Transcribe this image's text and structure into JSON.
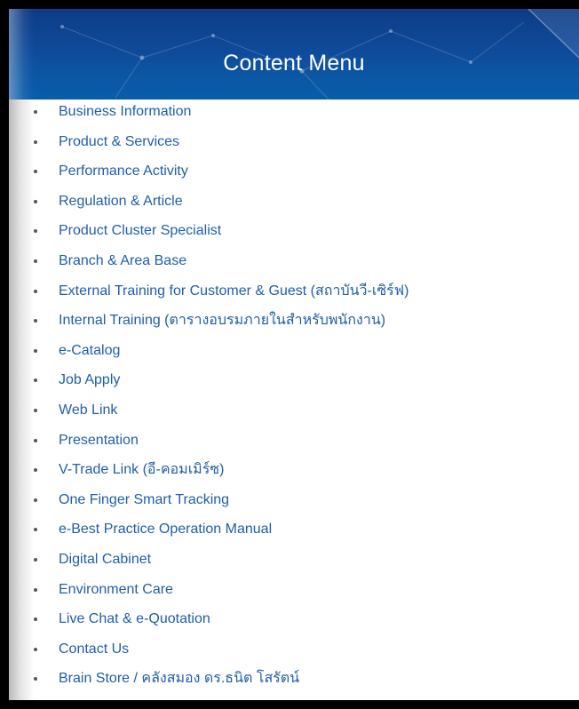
{
  "header": {
    "title": "Content Menu"
  },
  "colors": {
    "header_bg": "#0f4a99",
    "link": "#1f5fa8",
    "title_text": "#ffffff"
  },
  "menu": {
    "items": [
      "Business Information",
      "Product & Services",
      "Performance Activity",
      "Regulation & Article",
      "Product Cluster Specialist",
      "Branch & Area Base",
      "External Training for Customer & Guest (สถาบันวี-เซิร์ฟ)",
      "Internal Training (ตารางอบรมภายในสำหรับพนักงาน)",
      "e-Catalog",
      "Job Apply",
      "Web Link",
      "Presentation",
      "V-Trade Link (อี-คอมเมิร์ซ)",
      "One Finger Smart Tracking",
      "e-Best Practice Operation Manual",
      "Digital Cabinet",
      "Environment Care",
      "Live Chat & e-Quotation",
      "Contact Us",
      "Brain Store / คลังสมอง ดร.ธนิต โสรัตน์"
    ]
  }
}
